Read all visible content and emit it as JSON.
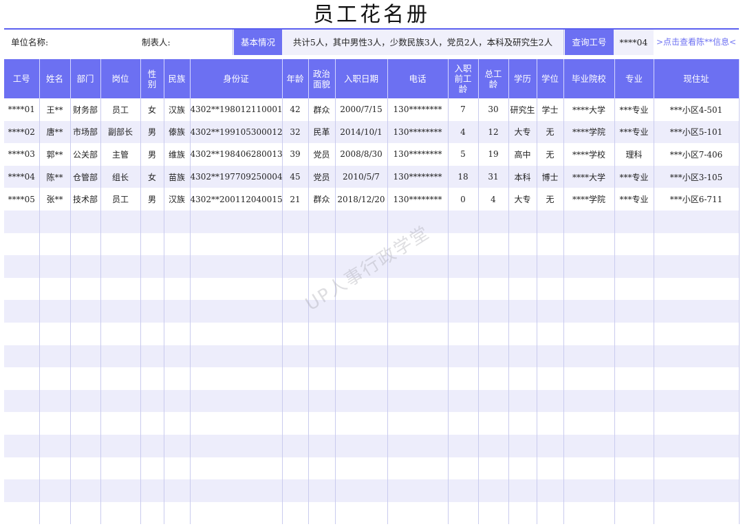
{
  "title": "员工花名册",
  "info": {
    "unit_label": "单位名称:",
    "maker_label": "制表人:",
    "basic_label": "基本情况",
    "basic_value": "共计5人，其中男性3人，少数民族3人，党员2人，本科及研究生2人",
    "query_label": "查询工号",
    "query_value": "****04",
    "query_link": ">点击查看陈**信息<"
  },
  "watermark": "UP人事行政学堂",
  "table": {
    "headers": [
      "工号",
      "姓名",
      "部门",
      "岗位",
      "性别",
      "民族",
      "身份证",
      "年龄",
      "政治面貌",
      "入职日期",
      "电话",
      "入职前工龄",
      "总工龄",
      "学历",
      "学位",
      "毕业院校",
      "专业",
      "现住址"
    ],
    "rows": [
      [
        "****01",
        "王**",
        "财务部",
        "员工",
        "女",
        "汉族",
        "4302**198012110001",
        "42",
        "群众",
        "2000/7/15",
        "130********",
        "7",
        "30",
        "研究生",
        "学士",
        "****大学",
        "***专业",
        "***小区4-501"
      ],
      [
        "****02",
        "唐**",
        "市场部",
        "副部长",
        "男",
        "傣族",
        "4302**199105300012",
        "32",
        "民革",
        "2014/10/1",
        "130********",
        "4",
        "12",
        "大专",
        "无",
        "****学院",
        "***专业",
        "***小区5-101"
      ],
      [
        "****03",
        "郭**",
        "公关部",
        "主管",
        "男",
        "维族",
        "4302**198406280013",
        "39",
        "党员",
        "2008/8/30",
        "130********",
        "5",
        "19",
        "高中",
        "无",
        "****学校",
        "理科",
        "***小区7-406"
      ],
      [
        "****04",
        "陈**",
        "仓管部",
        "组长",
        "女",
        "苗族",
        "4302**197709250004",
        "45",
        "党员",
        "2010/5/7",
        "130********",
        "18",
        "31",
        "本科",
        "博士",
        "****大学",
        "***专业",
        "***小区3-105"
      ],
      [
        "****05",
        "张**",
        "技术部",
        "员工",
        "男",
        "汉族",
        "4302**200112040015",
        "21",
        "群众",
        "2018/12/20",
        "130********",
        "0",
        "4",
        "大专",
        "无",
        "****学院",
        "***专业",
        "***小区6-711"
      ]
    ],
    "empty_rows": 14
  },
  "colors": {
    "accent": "#6c70f2",
    "stripe": "#ededfb"
  }
}
